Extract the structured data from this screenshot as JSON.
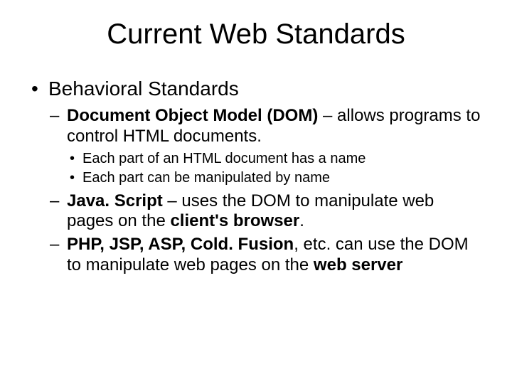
{
  "title": "Current Web Standards",
  "l1": {
    "item0": "Behavioral Standards"
  },
  "l2": {
    "i0": {
      "bold": "Document Object Model (DOM)",
      "rest": " – allows programs to control HTML documents."
    },
    "i1": {
      "bold": "Java. Script",
      "rest": " – uses the DOM to manipulate web pages on the ",
      "bold2": "client's browser",
      "tail": "."
    },
    "i2": {
      "bold": "PHP, JSP, ASP, Cold. Fusion",
      "rest": ", etc. can use the DOM to manipulate web pages on the ",
      "bold2": "web server",
      "tail": ""
    }
  },
  "l3": {
    "i0": "Each part of an HTML document has a name",
    "i1": "Each part can be manipulated by name"
  }
}
